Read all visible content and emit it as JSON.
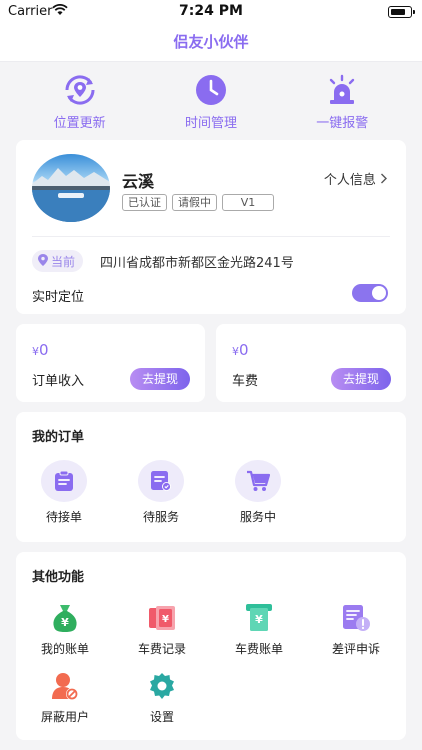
{
  "status_bar": {
    "carrier": "Carrier",
    "time": "7:24 PM"
  },
  "nav": {
    "title": "侣友小伙伴"
  },
  "quick_actions": [
    {
      "label": "位置更新",
      "icon": "location-refresh-icon"
    },
    {
      "label": "时间管理",
      "icon": "clock-icon"
    },
    {
      "label": "一键报警",
      "icon": "alarm-light-icon"
    }
  ],
  "profile": {
    "name": "云溪",
    "tags": [
      "已认证",
      "请假中",
      "V1"
    ],
    "personal_info": "个人信息",
    "location_badge": "当前",
    "address": "四川省成都市新都区金光路241号",
    "realtime_label": "实时定位",
    "realtime_on": true
  },
  "money": [
    {
      "currency": "¥",
      "amount": "0",
      "label": "订单收入",
      "button": "去提现"
    },
    {
      "currency": "¥",
      "amount": "0",
      "label": "车费",
      "button": "去提现"
    }
  ],
  "orders": {
    "title": "我的订单",
    "items": [
      {
        "label": "待接单",
        "icon": "clipboard-icon"
      },
      {
        "label": "待服务",
        "icon": "service-check-icon"
      },
      {
        "label": "服务中",
        "icon": "cart-icon"
      }
    ]
  },
  "other": {
    "title": "其他功能",
    "items": [
      {
        "label": "我的账单",
        "icon": "money-bag-icon"
      },
      {
        "label": "车费记录",
        "icon": "fare-record-icon"
      },
      {
        "label": "车费账单",
        "icon": "fare-bill-icon"
      },
      {
        "label": "差评申诉",
        "icon": "complaint-icon"
      },
      {
        "label": "屏蔽用户",
        "icon": "block-user-icon"
      },
      {
        "label": "设置",
        "icon": "settings-gear-icon"
      }
    ]
  },
  "colors": {
    "accent": "#8a6cf0",
    "accent_light": "#eeebfa",
    "background": "#f4f4f6"
  }
}
